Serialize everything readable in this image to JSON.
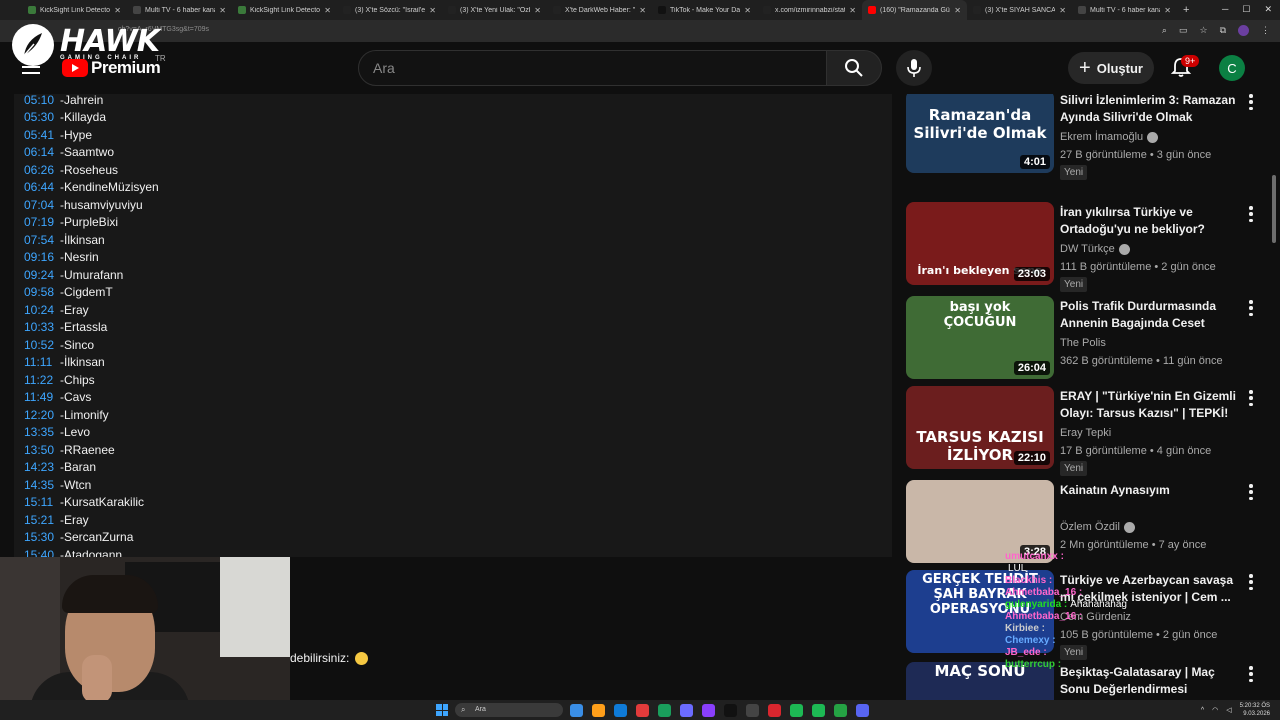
{
  "browser": {
    "tabs": [
      {
        "title": "KickSight Link Detector",
        "color": "#3b7a3b"
      },
      {
        "title": "Multi TV - 6 haber kanalı",
        "color": "#444"
      },
      {
        "title": "KickSight Link Detector",
        "color": "#3b7a3b"
      },
      {
        "title": "(3) X'te Sözcü: \"İsrail'e bo",
        "color": "#222"
      },
      {
        "title": "(3) X'te Yeni Ulak: \"Özbek",
        "color": "#222"
      },
      {
        "title": "X'te DarkWeb Haber: \"Cu",
        "color": "#222"
      },
      {
        "title": "TikTok - Make Your Day",
        "color": "#111"
      },
      {
        "title": "x.com/izmirinnabzi/status",
        "color": "#222"
      },
      {
        "title": "(160) \"Ramazanda Güldü",
        "color": "#ff0000",
        "active": true
      },
      {
        "title": "(3) X'te SİYAH SANCAK: \"",
        "color": "#222"
      },
      {
        "title": "Multi TV - 6 haber kanalı",
        "color": "#444"
      }
    ],
    "new_tab": "+",
    "url": "ch?v=A_r6VMTG3sg&t=709s"
  },
  "overlay_logo": {
    "name": "HAWK",
    "sub": "GAMING CHAIR"
  },
  "header": {
    "brand": "Premium",
    "country": "TR",
    "search_placeholder": "Ara",
    "create_label": "Oluştur",
    "notif_count": "9+",
    "avatar_letter": "C"
  },
  "timestamps": [
    {
      "time": "05:10",
      "name": "-Jahrein"
    },
    {
      "time": "05:30",
      "name": "-Killayda"
    },
    {
      "time": "05:41",
      "name": "-Hype"
    },
    {
      "time": "06:14",
      "name": "-Saamtwo"
    },
    {
      "time": "06:26",
      "name": "-Roseheus"
    },
    {
      "time": "06:44",
      "name": "-KendineMüzisyen"
    },
    {
      "time": "07:04",
      "name": "-husamviyuviyu"
    },
    {
      "time": "07:19",
      "name": "-PurpleBixi"
    },
    {
      "time": "07:54",
      "name": "-İlkinsan"
    },
    {
      "time": "09:16",
      "name": "-Nesrin"
    },
    {
      "time": "09:24",
      "name": "-Umurafann"
    },
    {
      "time": "09:58",
      "name": "-CigdemT"
    },
    {
      "time": "10:24",
      "name": "-Eray"
    },
    {
      "time": "10:33",
      "name": "-Ertassla"
    },
    {
      "time": "10:52",
      "name": "-Sinco"
    },
    {
      "time": "11:11",
      "name": "-İlkinsan"
    },
    {
      "time": "11:22",
      "name": "-Chips"
    },
    {
      "time": "11:49",
      "name": "-Cavs"
    },
    {
      "time": "12:20",
      "name": "-Limonify"
    },
    {
      "time": "13:35",
      "name": "-Levo"
    },
    {
      "time": "13:50",
      "name": "-RRaenee"
    },
    {
      "time": "14:23",
      "name": "-Baran"
    },
    {
      "time": "14:35",
      "name": "-Wtcn"
    },
    {
      "time": "15:11",
      "name": "-KursatKarakilic"
    },
    {
      "time": "15:21",
      "name": "-Eray"
    },
    {
      "time": "15:30",
      "name": "-SercanZurna"
    },
    {
      "time": "15:40",
      "name": "-Atadogann"
    }
  ],
  "overlay_message": "debilirsiniz:",
  "videos": [
    {
      "title": "Silivri İzlenimlerim 3: Ramazan Ayında Silivri'de Olmak",
      "channel": "Ekrem İmamoğlu",
      "verified": true,
      "meta": "27 B görüntüleme • 3 gün önce",
      "badge": "Yeni",
      "duration": "4:01",
      "thumb_caption": "Ramazan'da Silivri'de Olmak",
      "thumb_color": "#1e3b5c"
    },
    {
      "title": "İran yıkılırsa Türkiye ve Ortadoğu'yu ne bekliyor?",
      "channel": "DW Türkçe",
      "verified": true,
      "meta": "111 B görüntüleme • 2 gün önce",
      "badge": "Yeni",
      "duration": "23:03",
      "thumb_caption": "İran'ı bekleyen sena",
      "thumb_color": "#7a1b1b"
    },
    {
      "title": "Polis Trafik Durdurmasında Annenin Bagajında Ceset Buldu",
      "channel": "The Polis",
      "verified": false,
      "meta": "362 B görüntüleme • 11 gün önce",
      "badge": "",
      "duration": "26:04",
      "thumb_caption": "başı yok ÇOCUĞUN",
      "thumb_color": "#3f6b35"
    },
    {
      "title": "ERAY | \"Türkiye'nin En Gizemli Olayı: Tarsus Kazısı\" | TEPKİ! ...",
      "channel": "Eray Tepki",
      "verified": false,
      "meta": "17 B görüntüleme • 4 gün önce",
      "badge": "Yeni",
      "duration": "22:10",
      "thumb_caption": "TARSUS KAZISI İZLİYOR",
      "thumb_color": "#6b1e1e"
    },
    {
      "title": "Kainatın Aynasıyım",
      "channel": "Özlem Özdil",
      "verified": true,
      "meta": "2 Mn görüntüleme • 7 ay önce",
      "badge": "",
      "duration": "3:28",
      "thumb_caption": "",
      "thumb_color": "#c9b7a8"
    },
    {
      "title": "Türkiye ve Azerbaycan savaşa mı çekilmek isteniyor | Cem ...",
      "channel": "Cem Gürdeniz",
      "verified": false,
      "meta": "105 B görüntüleme • 2 gün önce",
      "badge": "Yeni",
      "duration": "",
      "thumb_caption": "GERÇEK TEHDİT ŞAH BAYRAK OPERASYONU",
      "thumb_color": "#1d3e8f"
    },
    {
      "title": "Beşiktaş-Galatasaray | Maç Sonu Değerlendirmesi",
      "channel": "",
      "verified": false,
      "meta": "",
      "badge": "",
      "duration": "",
      "thumb_caption": "MAÇ SONU",
      "thumb_color": "#1e2a55"
    }
  ],
  "chat": [
    {
      "user": "umutcanxx :",
      "msg": "",
      "color": "#ff66cc"
    },
    {
      "user": "",
      "msg": "LUL",
      "color": "#ffffff"
    },
    {
      "user": "Blackhis :",
      "msg": "",
      "color": "#ff66cc"
    },
    {
      "user": "Ahmetbaba_16 :",
      "msg": "",
      "color": "#ff66cc"
    },
    {
      "user": "gulenyarida :",
      "msg": "Ahahahahag",
      "color": "#22dd22"
    },
    {
      "user": "Ahmetbaba_16 :",
      "msg": "",
      "color": "#ff66cc"
    },
    {
      "user": "Kirbiee :",
      "msg": "",
      "color": "#cccccc"
    },
    {
      "user": "Chemexy :",
      "msg": "",
      "color": "#66aaff"
    },
    {
      "user": "JB_ede :",
      "msg": "",
      "color": "#ff66cc"
    },
    {
      "user": "butterrcup :",
      "msg": "",
      "color": "#33cc33"
    }
  ],
  "taskbar": {
    "search_placeholder": "Ara",
    "time": "5:20:32 ÖS",
    "date": "9.03.2026",
    "app_colors": [
      "#3a8ee6",
      "#ff9f1a",
      "#0f7bd8",
      "#e23b3b",
      "#1a9e5c",
      "#6b6bff",
      "#8a3ffc",
      "#111111",
      "#444444",
      "#d9262e",
      "#1db954",
      "#1db954",
      "#25a244",
      "#5865f2"
    ]
  }
}
